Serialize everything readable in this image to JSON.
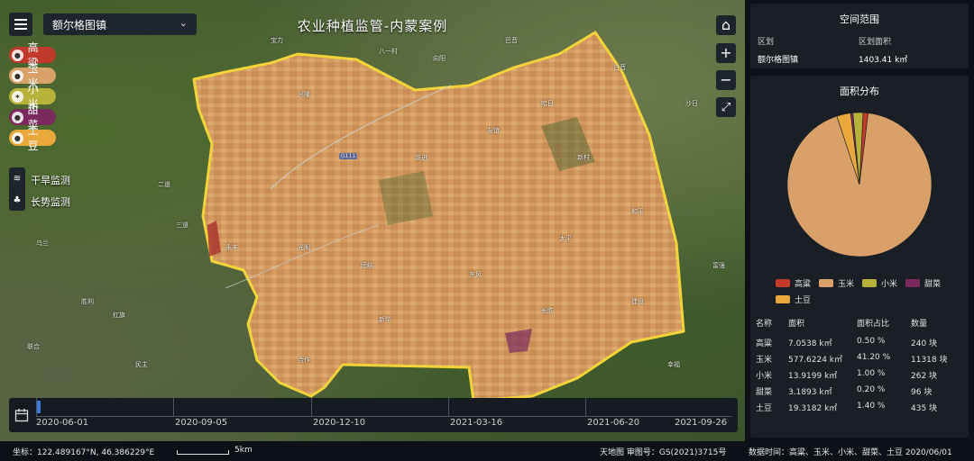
{
  "map": {
    "title": "农业种植监管-内蒙案例",
    "region_select": {
      "value": "额尔格图镇"
    },
    "crops": [
      {
        "label": "高粱",
        "color": "#c0392b",
        "icon": "sorghum-icon"
      },
      {
        "label": "玉米",
        "color": "#d9a06a",
        "icon": "corn-icon"
      },
      {
        "label": "小米",
        "color": "#b7b23a",
        "icon": "millet-icon"
      },
      {
        "label": "甜菜",
        "color": "#7a2a5e",
        "icon": "beet-icon"
      },
      {
        "label": "土豆",
        "color": "#e9a83c",
        "icon": "potato-icon"
      }
    ],
    "tools": [
      {
        "label": "干旱监测",
        "icon": "drought-icon"
      },
      {
        "label": "长势监测",
        "icon": "growth-icon"
      }
    ],
    "controls": {
      "home": "⌂",
      "zoom_in": "+",
      "zoom_out": "−",
      "fullscreen": "⤢"
    },
    "places": [
      "八一村",
      "宝力",
      "巴音",
      "哈日",
      "白音",
      "沙日",
      "二道",
      "三道",
      "乌兰",
      "胜利",
      "红旗",
      "兴隆",
      "前进",
      "友谊",
      "新村",
      "和平",
      "太平",
      "东风",
      "团结",
      "光明",
      "永丰",
      "新华",
      "长胜",
      "建设",
      "富强",
      "联合",
      "民主",
      "合作",
      "向阳",
      "幸福"
    ],
    "road_label": "G111"
  },
  "timeline": {
    "ticks": [
      "2020-06-01",
      "2020-09-05",
      "2020-12-10",
      "2021-03-16",
      "2021-06-20",
      "2021-09-26"
    ],
    "current": "2020-06-01"
  },
  "status": {
    "coord": "坐标：122.489167°N, 46.386229°E",
    "scale": "5km",
    "approval": "天地图 审图号：GS(2021)3715号",
    "data_time": "数据时间：高粱、玉米、小米、甜菜、土豆 2020/06/01"
  },
  "spatial_panel": {
    "title": "空间范围",
    "headers": [
      "区划",
      "区划面积"
    ],
    "values": [
      "额尔格图镇",
      "1403.41 k㎡"
    ]
  },
  "area_panel": {
    "title": "面积分布",
    "table_headers": [
      "名称",
      "面积",
      "面积占比",
      "数量"
    ],
    "rows": [
      {
        "name": "高粱",
        "area": "7.0538 k㎡",
        "pct": "0.50 %",
        "count": "240 块"
      },
      {
        "name": "玉米",
        "area": "577.6224 k㎡",
        "pct": "41.20 %",
        "count": "11318 块"
      },
      {
        "name": "小米",
        "area": "13.9199 k㎡",
        "pct": "1.00 %",
        "count": "262 块"
      },
      {
        "name": "甜菜",
        "area": "3.1893 k㎡",
        "pct": "0.20 %",
        "count": "96 块"
      },
      {
        "name": "土豆",
        "area": "19.3182 k㎡",
        "pct": "1.40 %",
        "count": "435 块"
      }
    ]
  },
  "chart_data": {
    "type": "pie",
    "labels": [
      "高粱",
      "玉米",
      "小米",
      "甜菜",
      "土豆"
    ],
    "values": [
      7.0538,
      577.6224,
      13.9199,
      3.1893,
      19.3182
    ],
    "colors": [
      "#c0392b",
      "#d9a06a",
      "#b7b23a",
      "#7a2a5e",
      "#e9a83c"
    ]
  }
}
